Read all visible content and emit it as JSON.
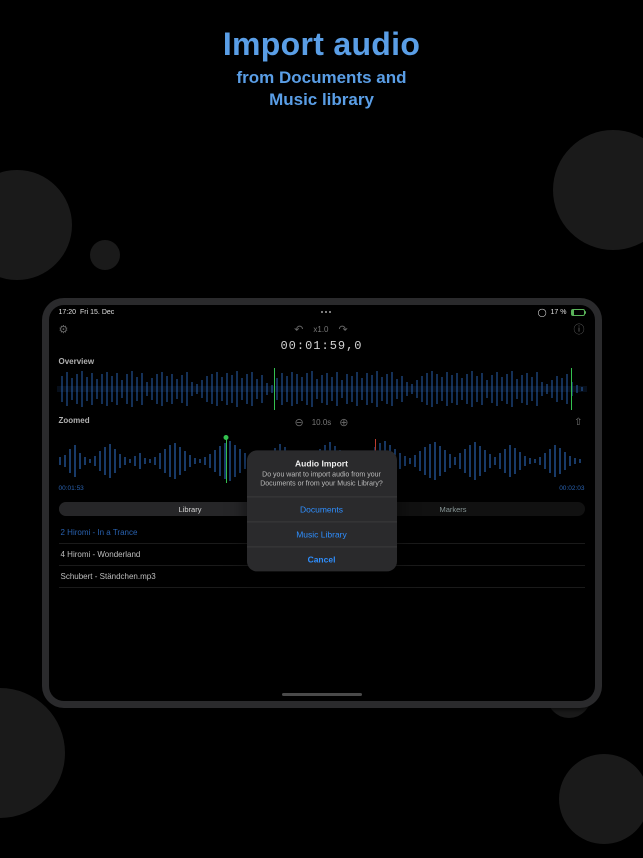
{
  "hero": {
    "title": "Import audio",
    "subtitle1": "from Documents and",
    "subtitle2": "Music library"
  },
  "status": {
    "time": "17:20",
    "date": "Fri 15. Dec",
    "battery_pct": "17 %"
  },
  "toolbar": {
    "speed_label": "x1.0"
  },
  "timecode": "00:01:59,0",
  "labels": {
    "overview": "Overview",
    "zoomed": "Zoomed"
  },
  "zoom": {
    "value": "10.0s"
  },
  "timemarks": {
    "start": "00:01:53",
    "end": "00:02:03"
  },
  "segmented": {
    "library": "Library",
    "markers": "Markers"
  },
  "tracks": [
    "2 Hiromi - In a Trance",
    "4 Hiromi - Wonderland",
    "Schubert - Ständchen.mp3"
  ],
  "dialog": {
    "title": "Audio Import",
    "message": "Do you want to import audio from your Documents or from your Music Library?",
    "documents": "Documents",
    "music_library": "Music Library",
    "cancel": "Cancel"
  }
}
